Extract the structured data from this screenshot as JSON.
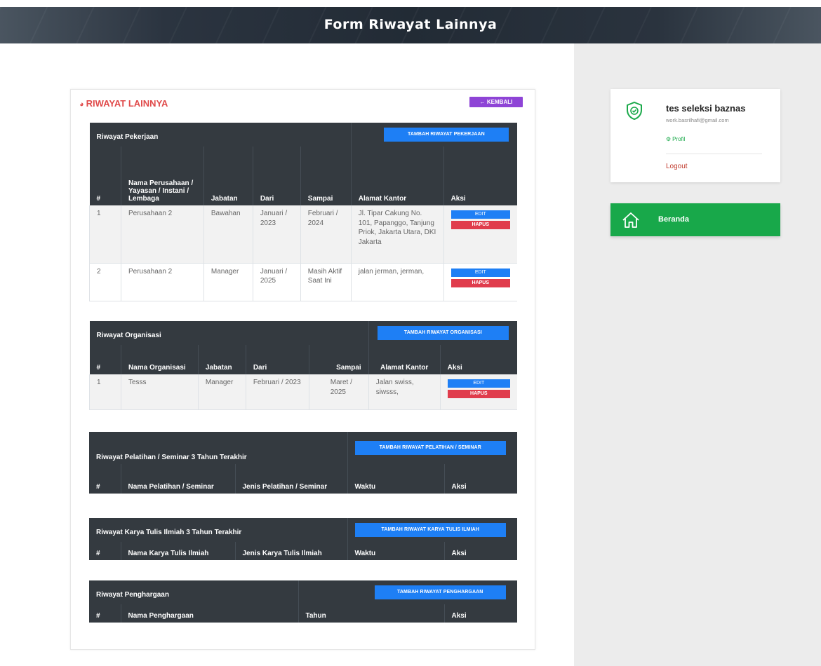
{
  "page": {
    "title": "Form Riwayat Lainnya"
  },
  "card": {
    "title": "RIWAYAT LAINNYA",
    "back_label": "KEMBALI"
  },
  "pekerjaan": {
    "title": "Riwayat Pekerjaan",
    "add_label": "TAMBAH RIWAYAT PEKERJAAN",
    "columns": [
      "#",
      "Nama Perusahaan / Yayasan / Instani / Lembaga",
      "Jabatan",
      "Dari",
      "Sampai",
      "Alamat Kantor",
      "Aksi"
    ],
    "rows": [
      {
        "no": "1",
        "nama": "Perusahaan 2",
        "jabatan": "Bawahan",
        "dari": "Januari / 2023",
        "sampai": "Februari / 2024",
        "alamat": "Jl. Tipar Cakung No. 101, Papanggo, Tanjung Priok, Jakarta Utara, DKI Jakarta"
      },
      {
        "no": "2",
        "nama": "Perusahaan 2",
        "jabatan": "Manager",
        "dari": "Januari / 2025",
        "sampai": "Masih Aktif Saat Ini",
        "alamat": "jalan jerman, jerman,"
      }
    ]
  },
  "organisasi": {
    "title": "Riwayat Organisasi",
    "add_label": "TAMBAH RIWAYAT ORGANISASI",
    "columns": [
      "#",
      "Nama Organisasi",
      "Jabatan",
      "Dari",
      "Sampai",
      "Alamat Kantor",
      "Aksi"
    ],
    "rows": [
      {
        "no": "1",
        "nama": "Tesss",
        "jabatan": "Manager",
        "dari": "Februari / 2023",
        "sampai": "Maret / 2025",
        "alamat": "Jalan swiss, siwsss,"
      }
    ]
  },
  "pelatihan": {
    "title": "Riwayat Pelatihan / Seminar 3 Tahun Terakhir",
    "add_label": "TAMBAH RIWAYAT PELATIHAN / SEMINAR",
    "columns": [
      "#",
      "Nama Pelatihan / Seminar",
      "Jenis Pelatihan / Seminar",
      "Waktu",
      "Aksi"
    ]
  },
  "karya": {
    "title": "Riwayat Karya Tulis Ilmiah 3 Tahun Terakhir",
    "add_label": "TAMBAH RIWAYAT KARYA TULIS ILMIAH",
    "columns": [
      "#",
      "Nama Karya Tulis Ilmiah",
      "Jenis Karya Tulis Ilmiah",
      "Waktu",
      "Aksi"
    ]
  },
  "penghargaan": {
    "title": "Riwayat Penghargaan",
    "add_label": "TAMBAH RIWAYAT PENGHARGAAN",
    "columns": [
      "#",
      "Nama Penghargaan",
      "Tahun",
      "Aksi"
    ]
  },
  "actions": {
    "edit": "EDIT",
    "hapus": "HAPUS"
  },
  "user": {
    "name": "tes seleksi baznas",
    "email": "work.basrilhafi@gmail.com",
    "profil": "Profil",
    "logout": "Logout"
  },
  "nav": {
    "beranda": "Beranda"
  },
  "colors": {
    "accent_red": "#e04b4b",
    "purple": "#8e44d6",
    "blue": "#1e7ff5",
    "danger": "#e03c4c",
    "green": "#18a84a",
    "dark": "#343a40"
  }
}
